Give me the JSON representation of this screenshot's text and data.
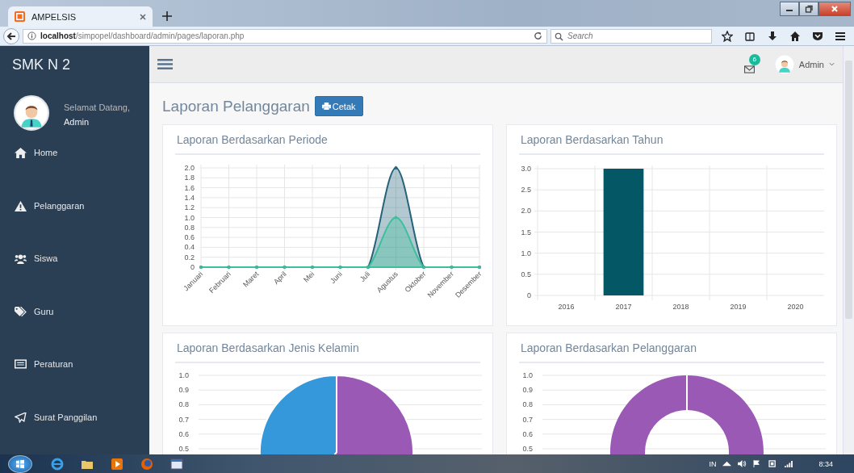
{
  "browser": {
    "tab": {
      "title": "AMPELSIS",
      "selected": true
    },
    "address": "**localhost**/simpopel/dashboard/admin/pages/laporan.php",
    "search": {
      "placeholder": "Search"
    }
  },
  "sidebar": {
    "brand": "SMK N 2",
    "greeting": "Selamat Datang,",
    "user": "Admin",
    "items": [
      {
        "label": "Home"
      },
      {
        "label": "Pelanggaran"
      },
      {
        "label": "Siswa"
      },
      {
        "label": "Guru"
      },
      {
        "label": "Peraturan"
      },
      {
        "label": "Surat Panggilan"
      }
    ]
  },
  "topbar": {
    "notification_count": "6",
    "user": "Admin"
  },
  "page": {
    "title": "Laporan Pelanggaran",
    "print_button": "Cetak"
  },
  "cards": [
    {
      "kind": "line",
      "title": "Laporan Berdasarkan Periode",
      "chart_data": {
        "type": "area",
        "categories": [
          "Januari",
          "Februari",
          "Maret",
          "April",
          "Mei",
          "Juni",
          "Juli",
          "Agustus",
          "Oktober",
          "November",
          "Desember"
        ],
        "series": [
          {
            "color": "#26637a",
            "values": [
              0,
              0,
              0,
              0,
              0,
              0,
              0,
              2,
              0,
              0,
              0
            ]
          },
          {
            "color": "#3cbf9c",
            "values": [
              0,
              0,
              0,
              0,
              0,
              0,
              0,
              1,
              0,
              0,
              0
            ]
          }
        ],
        "grid": true,
        "ylim": [
          0,
          2
        ],
        "yticks": [
          0,
          0.2,
          0.4,
          0.6,
          0.8,
          {
            "value": 1,
            "label": "1.0"
          },
          1.2,
          1.4,
          1.6,
          1.8,
          {
            "value": 2,
            "label": "2.0"
          }
        ]
      }
    },
    {
      "kind": "bar",
      "title": "Laporan Berdasarkan Tahun",
      "chart_data": {
        "type": "bar",
        "categories": [
          "2016",
          "2017",
          "2018",
          "2019",
          "2020"
        ],
        "series": [
          {
            "color": "#045866",
            "values": [
              0,
              3,
              0,
              0,
              0
            ]
          }
        ],
        "grid": true,
        "ylim": [
          0,
          3
        ],
        "yticks": [
          0,
          0.5,
          {
            "value": 1,
            "label": "1.0"
          },
          1.5,
          {
            "value": 2,
            "label": "2.0"
          },
          2.5,
          {
            "value": 3,
            "label": "3.0"
          }
        ]
      }
    },
    {
      "kind": "pie",
      "title": "Laporan Berdasarkan Jenis Kelamin",
      "axis_labels": [
        "1.0",
        "0.9",
        "0.8",
        "0.7",
        "0.6",
        "0.5"
      ]
    },
    {
      "kind": "donut",
      "title": "Laporan Berdasarkan Pelanggaran",
      "axis_labels": [
        "1.0",
        "0.9",
        "0.8",
        "0.7",
        "0.6",
        "0.5"
      ]
    }
  ],
  "taskbar": {
    "language": "IN",
    "time": "8:34"
  }
}
